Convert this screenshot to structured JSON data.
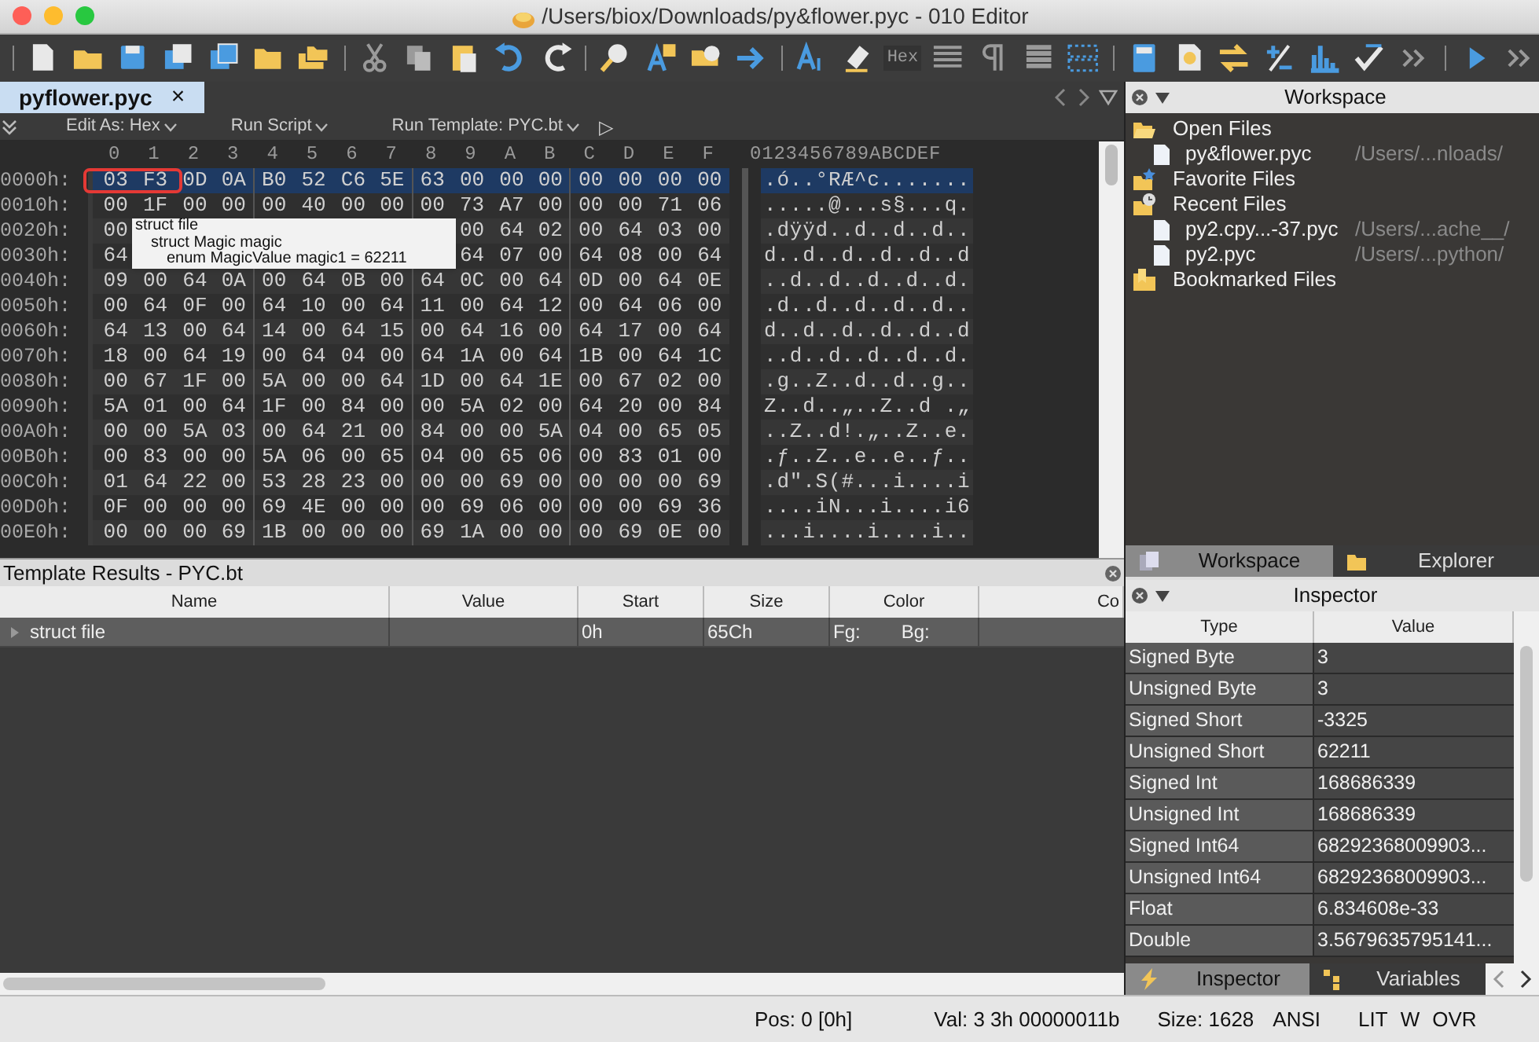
{
  "window": {
    "title": "/Users/biox/Downloads/py&flower.pyc - 010 Editor"
  },
  "toolbar": {
    "hex_label": "Hex"
  },
  "tabs": [
    {
      "label": "pyflower.pyc",
      "close": "×",
      "selected": true
    }
  ],
  "editor_bar": {
    "items": [
      "Edit As: Hex",
      "Run Script",
      "Run Template: PYC.bt"
    ],
    "run": "▷"
  },
  "hex": {
    "columns": [
      "0",
      "1",
      "2",
      "3",
      "4",
      "5",
      "6",
      "7",
      "8",
      "9",
      "A",
      "B",
      "C",
      "D",
      "E",
      "F"
    ],
    "ascii_header": "0123456789ABCDEF",
    "rows": [
      {
        "offset": "0000h:",
        "bytes": [
          "03",
          "F3",
          "0D",
          "0A",
          "B0",
          "52",
          "C6",
          "5E",
          "63",
          "00",
          "00",
          "00",
          "00",
          "00",
          "00",
          "00"
        ],
        "ascii": ".ó..°RÆ^c.......",
        "selected": true
      },
      {
        "offset": "0010h:",
        "bytes": [
          "00",
          "1F",
          "00",
          "00",
          "00",
          "40",
          "00",
          "00",
          "00",
          "73",
          "A7",
          "00",
          "00",
          "00",
          "71",
          "06"
        ],
        "ascii": ".....@...s§...q.",
        "selected": false
      },
      {
        "offset": "0020h:",
        "covered": true,
        "bytes": [
          "00",
          "00",
          "64",
          "02",
          "00",
          "64",
          "03",
          "00"
        ],
        "ascii": ".dÿÿd..d..d..d..",
        "selected": false
      },
      {
        "offset": "0030h:",
        "covered": true,
        "bytes": [
          "64",
          "64",
          "07",
          "00",
          "64",
          "08",
          "00",
          "64"
        ],
        "ascii": "d..d..d..d..d..d",
        "selected": false
      },
      {
        "offset": "0040h:",
        "bytes": [
          "09",
          "00",
          "64",
          "0A",
          "00",
          "64",
          "0B",
          "00",
          "64",
          "0C",
          "00",
          "64",
          "0D",
          "00",
          "64",
          "0E"
        ],
        "ascii": "..d..d..d..d..d.",
        "selected": false
      },
      {
        "offset": "0050h:",
        "bytes": [
          "00",
          "64",
          "0F",
          "00",
          "64",
          "10",
          "00",
          "64",
          "11",
          "00",
          "64",
          "12",
          "00",
          "64",
          "06",
          "00"
        ],
        "ascii": ".d..d..d..d..d..",
        "selected": false
      },
      {
        "offset": "0060h:",
        "bytes": [
          "64",
          "13",
          "00",
          "64",
          "14",
          "00",
          "64",
          "15",
          "00",
          "64",
          "16",
          "00",
          "64",
          "17",
          "00",
          "64"
        ],
        "ascii": "d..d..d..d..d..d",
        "selected": false
      },
      {
        "offset": "0070h:",
        "bytes": [
          "18",
          "00",
          "64",
          "19",
          "00",
          "64",
          "04",
          "00",
          "64",
          "1A",
          "00",
          "64",
          "1B",
          "00",
          "64",
          "1C"
        ],
        "ascii": "..d..d..d..d..d.",
        "selected": false
      },
      {
        "offset": "0080h:",
        "bytes": [
          "00",
          "67",
          "1F",
          "00",
          "5A",
          "00",
          "00",
          "64",
          "1D",
          "00",
          "64",
          "1E",
          "00",
          "67",
          "02",
          "00"
        ],
        "ascii": ".g..Z..d..d..g..",
        "selected": false
      },
      {
        "offset": "0090h:",
        "bytes": [
          "5A",
          "01",
          "00",
          "64",
          "1F",
          "00",
          "84",
          "00",
          "00",
          "5A",
          "02",
          "00",
          "64",
          "20",
          "00",
          "84"
        ],
        "ascii": "Z..d..„..Z..d .„",
        "selected": false
      },
      {
        "offset": "00A0h:",
        "bytes": [
          "00",
          "00",
          "5A",
          "03",
          "00",
          "64",
          "21",
          "00",
          "84",
          "00",
          "00",
          "5A",
          "04",
          "00",
          "65",
          "05"
        ],
        "ascii": "..Z..d!.„..Z..e.",
        "selected": false
      },
      {
        "offset": "00B0h:",
        "bytes": [
          "00",
          "83",
          "00",
          "00",
          "5A",
          "06",
          "00",
          "65",
          "04",
          "00",
          "65",
          "06",
          "00",
          "83",
          "01",
          "00"
        ],
        "ascii": ".ƒ..Z..e..e..ƒ..",
        "selected": false
      },
      {
        "offset": "00C0h:",
        "bytes": [
          "01",
          "64",
          "22",
          "00",
          "53",
          "28",
          "23",
          "00",
          "00",
          "00",
          "69",
          "00",
          "00",
          "00",
          "00",
          "69"
        ],
        "ascii": ".d\".S(#...i....i",
        "selected": false
      },
      {
        "offset": "00D0h:",
        "bytes": [
          "0F",
          "00",
          "00",
          "00",
          "69",
          "4E",
          "00",
          "00",
          "00",
          "69",
          "06",
          "00",
          "00",
          "00",
          "69",
          "36"
        ],
        "ascii": "....iN...i....i6",
        "selected": false
      },
      {
        "offset": "00E0h:",
        "bytes": [
          "00",
          "00",
          "00",
          "69",
          "1B",
          "00",
          "00",
          "00",
          "69",
          "1A",
          "00",
          "00",
          "00",
          "69",
          "0E",
          "00"
        ],
        "ascii": "...i....i....i..",
        "selected": false
      }
    ],
    "tooltip": [
      "struct file",
      "struct Magic magic",
      "enum MagicValue magic1 = 62211"
    ]
  },
  "workspace": {
    "title": "Workspace",
    "groups": [
      {
        "label": "Open Files",
        "kind": "open",
        "children": [
          {
            "name": "py&flower.pyc",
            "path": "/Users/...nloads/"
          }
        ]
      },
      {
        "label": "Favorite Files",
        "kind": "favorite"
      },
      {
        "label": "Recent Files",
        "kind": "recent",
        "children": [
          {
            "name": "py2.cpy...-37.pyc",
            "path": "/Users/...ache__/"
          },
          {
            "name": "py2.pyc",
            "path": "/Users/...python/"
          }
        ]
      },
      {
        "label": "Bookmarked Files",
        "kind": "bookmarked"
      }
    ],
    "tabs": [
      {
        "label": "Workspace",
        "selected": true
      },
      {
        "label": "Explorer",
        "selected": false
      }
    ]
  },
  "template_results": {
    "title": "Template Results - PYC.bt",
    "columns": [
      "Name",
      "Value",
      "Start",
      "Size",
      "Color",
      "Co"
    ],
    "rows": [
      {
        "name": "struct file",
        "value": "",
        "start": "0h",
        "size": "65Ch",
        "fg": "Fg:",
        "bg": "Bg:"
      }
    ]
  },
  "inspector": {
    "title": "Inspector",
    "columns": [
      "Type",
      "Value"
    ],
    "rows": [
      {
        "type": "Signed Byte",
        "value": "3"
      },
      {
        "type": "Unsigned Byte",
        "value": "3"
      },
      {
        "type": "Signed Short",
        "value": "-3325"
      },
      {
        "type": "Unsigned Short",
        "value": "62211"
      },
      {
        "type": "Signed Int",
        "value": "168686339"
      },
      {
        "type": "Unsigned Int",
        "value": "168686339"
      },
      {
        "type": "Signed Int64",
        "value": "68292368009903..."
      },
      {
        "type": "Unsigned Int64",
        "value": "68292368009903..."
      },
      {
        "type": "Float",
        "value": "6.834608e-33"
      },
      {
        "type": "Double",
        "value": "3.5679635795141..."
      }
    ],
    "tabs": [
      {
        "label": "Inspector",
        "selected": true
      },
      {
        "label": "Variables",
        "selected": false
      }
    ]
  },
  "status_bar": [
    "Pos: 0 [0h]",
    "Val: 3 3h 00000011b",
    "Size: 1628",
    "ANSI",
    "LIT",
    "W",
    "OVR"
  ]
}
